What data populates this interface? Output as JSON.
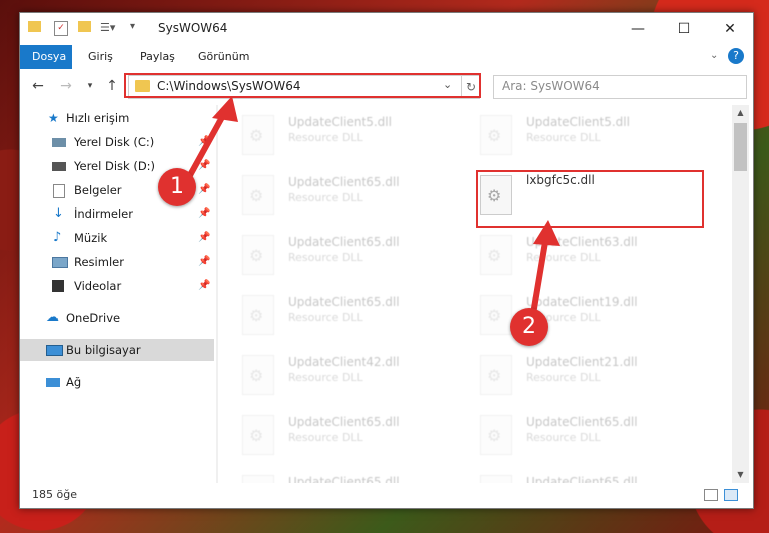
{
  "window": {
    "title": "SysWOW64"
  },
  "ribbon": {
    "tabs": [
      "Dosya",
      "Giriş",
      "Paylaş",
      "Görünüm"
    ]
  },
  "address": {
    "path": "C:\\Windows\\SysWOW64"
  },
  "search": {
    "placeholder": "Ara: SysWOW64"
  },
  "sidebar": {
    "items": [
      {
        "label": "Hızlı erişim"
      },
      {
        "label": "Yerel Disk (C:)"
      },
      {
        "label": "Yerel Disk (D:)"
      },
      {
        "label": "Belgeler"
      },
      {
        "label": "İndirmeler"
      },
      {
        "label": "Müzik"
      },
      {
        "label": "Resimler"
      },
      {
        "label": "Videolar"
      },
      {
        "label": "OneDrive"
      },
      {
        "label": "Bu bilgisayar"
      },
      {
        "label": "Ağ"
      }
    ]
  },
  "files": {
    "left": [
      {
        "name": "UpdateClient5.dll",
        "type": "Resource DLL"
      },
      {
        "name": "UpdateClient65.dll",
        "type": "Resource DLL"
      },
      {
        "name": "UpdateClient65.dll",
        "type": "Resource DLL"
      },
      {
        "name": "UpdateClient65.dll",
        "type": "Resource DLL"
      },
      {
        "name": "UpdateClient42.dll",
        "type": "Resource DLL"
      },
      {
        "name": "UpdateClient65.dll",
        "type": "Resource DLL"
      },
      {
        "name": "UpdateClient65.dll",
        "type": "Resource DLL"
      }
    ],
    "right": [
      {
        "name": "UpdateClient5.dll",
        "type": "Resource DLL"
      },
      {
        "name": "lxbgfc5c.dll",
        "type": ""
      },
      {
        "name": "UpdateClient63.dll",
        "type": "Resource DLL"
      },
      {
        "name": "UpdateClient19.dll",
        "type": "Resource DLL"
      },
      {
        "name": "UpdateClient21.dll",
        "type": "Resource DLL"
      },
      {
        "name": "UpdateClient65.dll",
        "type": "Resource DLL"
      },
      {
        "name": "UpdateClient65.dll",
        "type": "Resource DLL"
      }
    ]
  },
  "status": {
    "count": "185 öğe"
  },
  "annotations": {
    "step1": "1",
    "step2": "2",
    "color": "#e0312f"
  }
}
